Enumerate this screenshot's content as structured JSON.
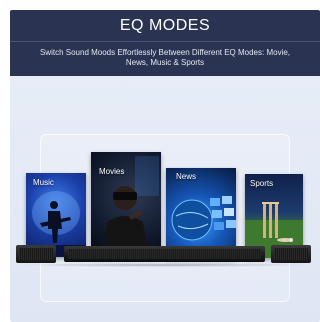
{
  "header": {
    "title": "EQ MODES",
    "subtitle": "Switch Sound Moods Effortlessly Between Different EQ Modes: Movie, News, Music & Sports"
  },
  "panels": {
    "music": {
      "label": "Music"
    },
    "movies": {
      "label": "Movies"
    },
    "news": {
      "label": "News"
    },
    "sports": {
      "label": "Sports"
    }
  },
  "colors": {
    "header_bg": "#2a3351",
    "background": "#e4eaf5",
    "soundbar": "#1a1a1a"
  }
}
